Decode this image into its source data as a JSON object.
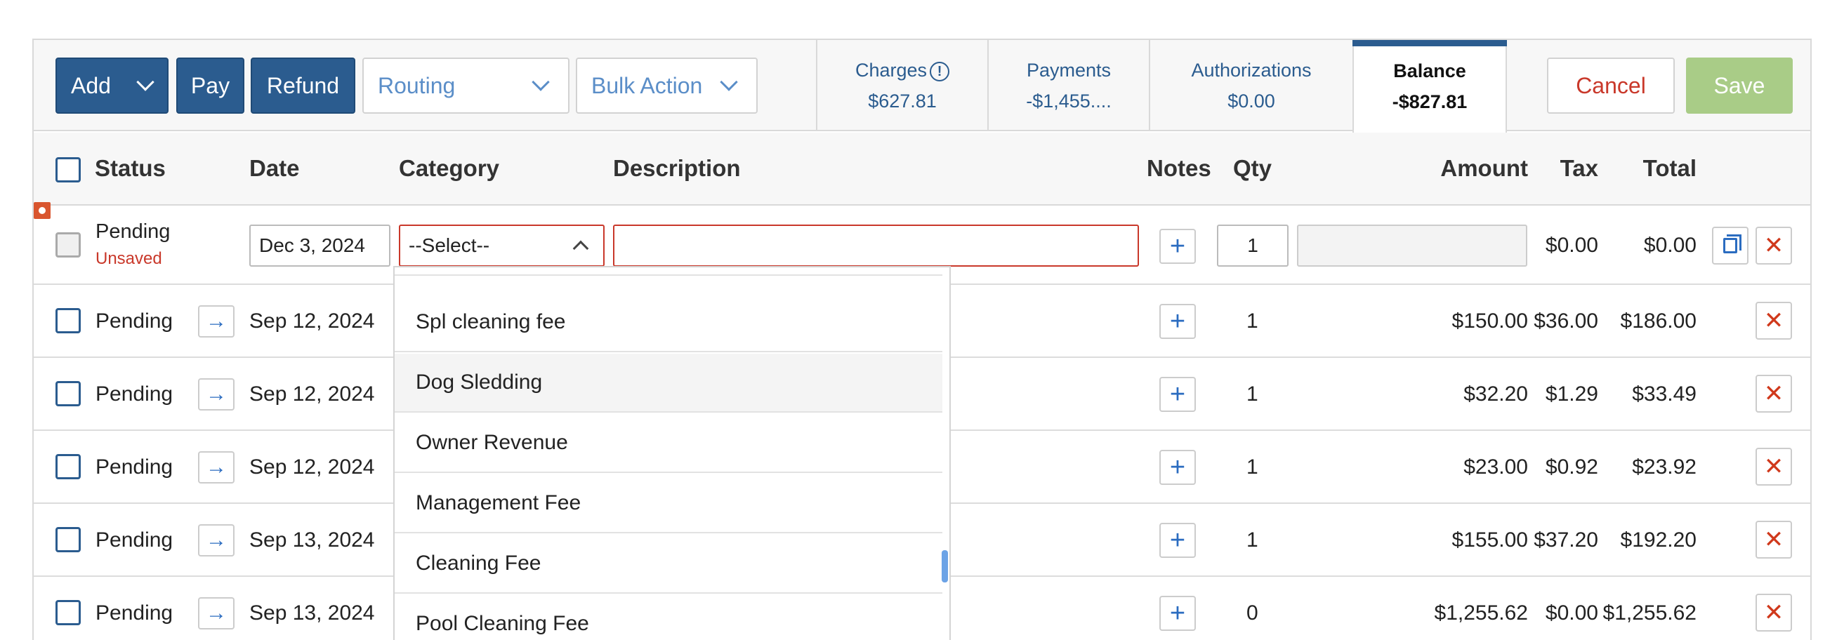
{
  "toolbar": {
    "add_label": "Add",
    "pay_label": "Pay",
    "refund_label": "Refund",
    "routing_placeholder": "Routing",
    "bulk_action_placeholder": "Bulk Action",
    "cancel_label": "Cancel",
    "save_label": "Save"
  },
  "tabs": [
    {
      "label": "Charges",
      "value": "$627.81"
    },
    {
      "label": "Payments",
      "value": "-$1,455...."
    },
    {
      "label": "Authorizations",
      "value": "$0.00"
    },
    {
      "label": "Balance",
      "value": "-$827.81"
    }
  ],
  "columns": {
    "status": "Status",
    "date": "Date",
    "category": "Category",
    "description": "Description",
    "notes": "Notes",
    "qty": "Qty",
    "amount": "Amount",
    "tax": "Tax",
    "total": "Total"
  },
  "new_row": {
    "status": "Pending",
    "status_note": "Unsaved",
    "date": "Dec 3, 2024",
    "category_placeholder": "--Select--",
    "description": "",
    "qty": "1",
    "amount": "",
    "tax": "$0.00",
    "total": "$0.00"
  },
  "rows": [
    {
      "status": "Pending",
      "date": "Sep 12, 2024",
      "qty": "1",
      "amount": "$150.00",
      "tax": "$36.00",
      "total": "$186.00"
    },
    {
      "status": "Pending",
      "date": "Sep 12, 2024",
      "qty": "1",
      "amount": "$32.20",
      "tax": "$1.29",
      "total": "$33.49"
    },
    {
      "status": "Pending",
      "date": "Sep 12, 2024",
      "qty": "1",
      "amount": "$23.00",
      "tax": "$0.92",
      "total": "$23.92"
    },
    {
      "status": "Pending",
      "date": "Sep 13, 2024",
      "qty": "1",
      "amount": "$155.00",
      "tax": "$37.20",
      "total": "$192.20"
    },
    {
      "status": "Pending",
      "date": "Sep 13, 2024",
      "qty": "0",
      "amount": "$1,255.62",
      "tax": "$0.00",
      "total": "$1,255.62"
    }
  ],
  "dropdown": {
    "items": [
      "Spl cleaning fee",
      "Dog Sledding",
      "Owner Revenue",
      "Management Fee",
      "Cleaning Fee",
      "Pool Cleaning Fee"
    ],
    "highlighted": "Dog Sledding"
  },
  "icons": {
    "arrow": "→",
    "plus": "+",
    "close": "✕",
    "info": "!"
  },
  "colors": {
    "primary": "#2b5c8f",
    "danger": "#c9382a",
    "save_disabled": "#a9cc87"
  }
}
